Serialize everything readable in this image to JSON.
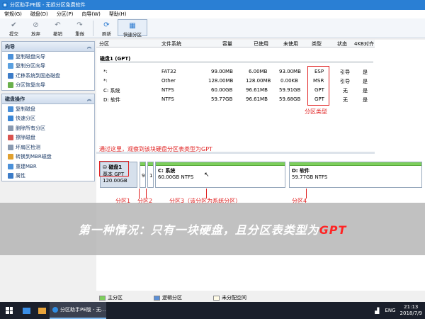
{
  "titlebar": {
    "title": "分区助手PE版 - 无损分区免费软件"
  },
  "menu": [
    "常规(G)",
    "磁盘(D)",
    "分区(P)",
    "向导(W)",
    "帮助(H)"
  ],
  "toolbar": {
    "commit": "提交",
    "discard": "放弃",
    "undo": "撤销",
    "redo": "重做",
    "refresh": "刷新",
    "quick_partition": "快速分区"
  },
  "sidebar": {
    "wizard_title": "向导",
    "wizard_items": [
      "复制磁盘向导",
      "复制分区向导",
      "迁移系统到固态磁盘",
      "分区恢复向导"
    ],
    "disk_ops_title": "磁盘操作",
    "disk_ops_items": [
      "复制磁盘",
      "快速分区",
      "删除所有分区",
      "擦除磁盘",
      "坏扇区检测",
      "转换到MBR磁盘",
      "重建MBR",
      "属性"
    ]
  },
  "table": {
    "headers": [
      "分区",
      "文件系统",
      "容量",
      "已使用",
      "未使用",
      "类型",
      "状态",
      "4KB对齐"
    ],
    "disk_label": "磁盘1 (GPT)",
    "rows": [
      {
        "part": "*:",
        "fs": "FAT32",
        "cap": "99.00MB",
        "used": "6.00MB",
        "free": "93.00MB",
        "type": "ESP",
        "status": "引导",
        "align": "是"
      },
      {
        "part": "*:",
        "fs": "Other",
        "cap": "128.00MB",
        "used": "128.00MB",
        "free": "0.00KB",
        "type": "MSR",
        "status": "引导",
        "align": "是"
      },
      {
        "part": "C: 系统",
        "fs": "NTFS",
        "cap": "60.00GB",
        "used": "96.61MB",
        "free": "59.91GB",
        "type": "GPT",
        "status": "无",
        "align": "是"
      },
      {
        "part": "D: 软件",
        "fs": "NTFS",
        "cap": "59.77GB",
        "used": "96.61MB",
        "free": "59.68GB",
        "type": "GPT",
        "status": "无",
        "align": "是"
      }
    ]
  },
  "annotations": {
    "partition_type": "分区类型",
    "hint": "通过这里，观察到该块硬盘分区表类型为GPT",
    "part1": "分区1",
    "part2": "分区2",
    "part3": "分区3（该分区为系统分区）",
    "part4": "分区4"
  },
  "diskmap": {
    "disk_name": "磁盘1",
    "disk_type": "基本 GPT",
    "disk_size": "120.00GB",
    "p1_num": "9",
    "p2_num": "1",
    "c_name": "C: 系统",
    "c_info": "60.00GB NTFS",
    "d_name": "D: 软件",
    "d_info": "59.77GB NTFS"
  },
  "caption": {
    "main": "第一种情况：只有一块硬盘，且分区表类型为",
    "gpt": "GPT"
  },
  "legend": {
    "primary": "主分区",
    "logical": "逻辑分区",
    "unallocated": "未分配空间"
  },
  "taskbar": {
    "app_label": "分区助手PE版 - 无...",
    "lang": "ENG",
    "time": "21:13",
    "date": "2018/7/9"
  },
  "colors": {
    "accent": "#2a7fd4",
    "annotation_red": "#e02020",
    "partition_green": "#7dcf5c"
  }
}
